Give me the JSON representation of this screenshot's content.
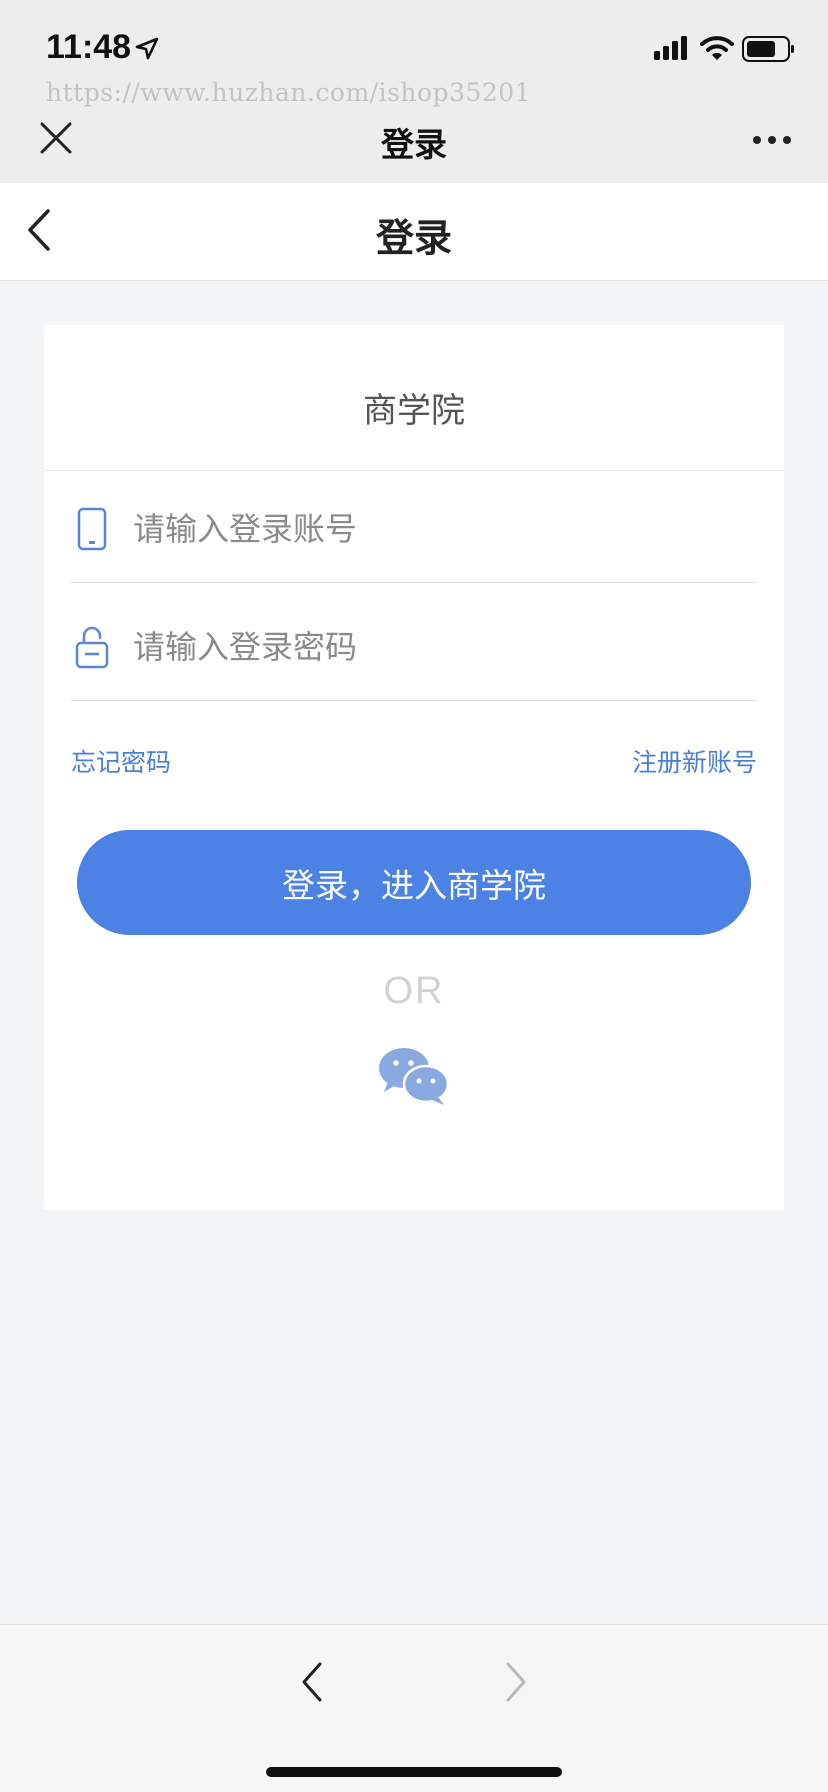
{
  "status_bar": {
    "time": "11:48",
    "location_icon": "location-arrow-icon",
    "signal_icon": "cellular-signal-icon",
    "wifi_icon": "wifi-icon",
    "battery_icon": "battery-icon"
  },
  "browser": {
    "url": "https://www.huzhan.com/ishop35201",
    "title": "登录",
    "close_icon": "close-icon",
    "more_icon": "more-icon"
  },
  "nav": {
    "title": "登录",
    "back_icon": "back-chevron-icon"
  },
  "login_card": {
    "title": "商学院",
    "account_placeholder": "请输入登录账号",
    "password_placeholder": "请输入登录密码",
    "forgot_password": "忘记密码",
    "register": "注册新账号",
    "login_button": "登录，进入商学院",
    "or_text": "OR",
    "wechat_icon": "wechat-icon"
  },
  "bottom_toolbar": {
    "back_icon": "chevron-left-icon",
    "forward_icon": "chevron-right-icon"
  },
  "colors": {
    "accent": "#4b82e3",
    "link": "#4a7fd6",
    "background": "#f3f4f6",
    "icon_blue": "#5a86d6",
    "wechat_icon": "#8aa9e0"
  }
}
